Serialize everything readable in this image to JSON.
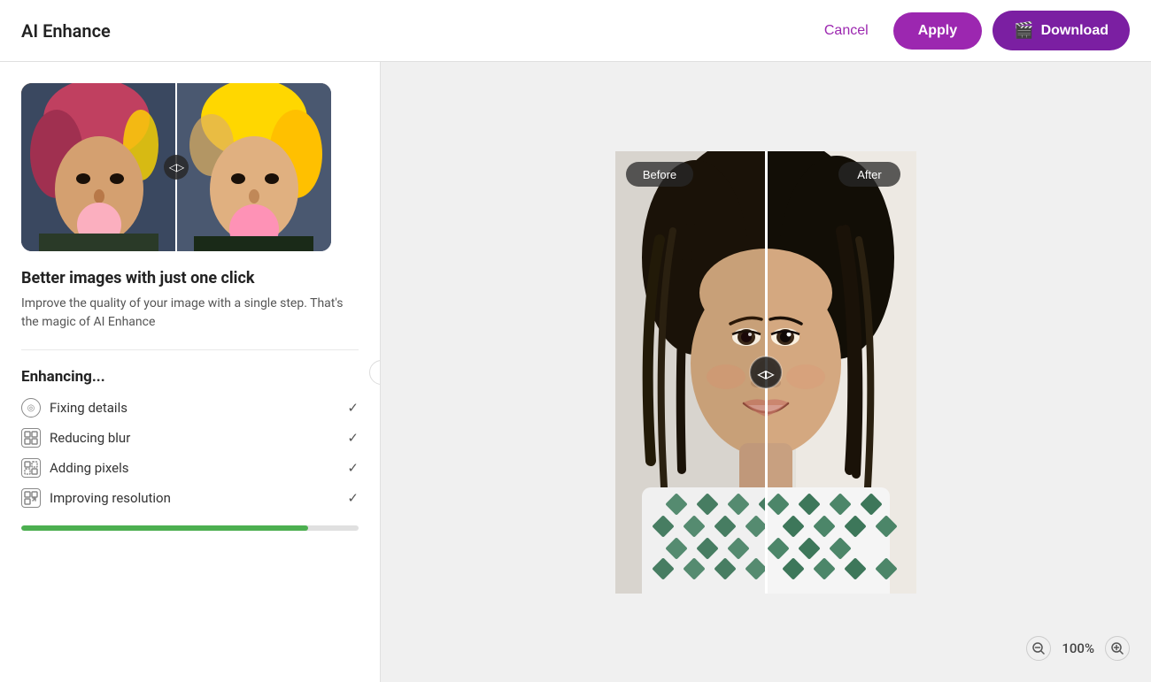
{
  "header": {
    "title": "AI Enhance",
    "cancel_label": "Cancel",
    "apply_label": "Apply",
    "download_label": "Download"
  },
  "left_panel": {
    "preview_title": "Better images with just one click",
    "preview_desc": "Improve the quality of your image with a single step. That's the magic of AI Enhance",
    "enhancing_title": "Enhancing...",
    "items": [
      {
        "label": "Fixing details",
        "icon_type": "circle",
        "checked": true
      },
      {
        "label": "Reducing blur",
        "icon_type": "square",
        "checked": true
      },
      {
        "label": "Adding pixels",
        "icon_type": "square",
        "checked": true
      },
      {
        "label": "Improving resolution",
        "icon_type": "square",
        "checked": true
      }
    ]
  },
  "comparison": {
    "before_label": "Before",
    "after_label": "After"
  },
  "zoom": {
    "level": "100%"
  }
}
